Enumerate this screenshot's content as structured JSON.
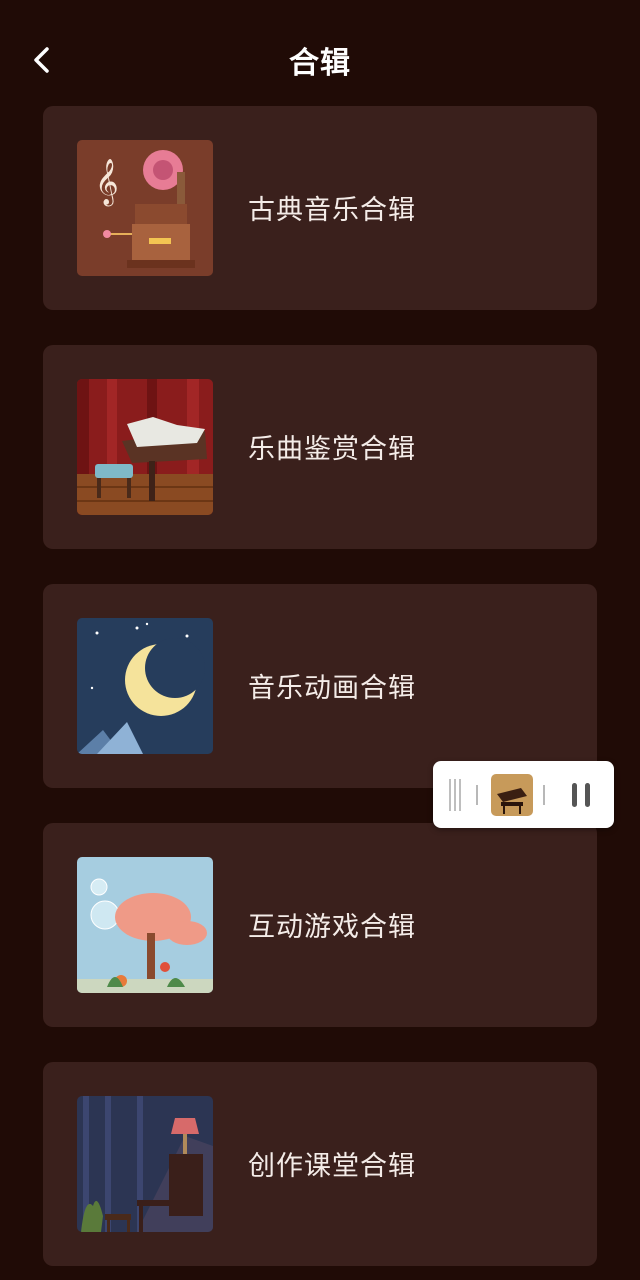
{
  "header": {
    "title": "合辑",
    "back_icon": "chevron-left-icon"
  },
  "albums": [
    {
      "label": "古典音乐合辑",
      "image": "gramophone-music-box-illustration"
    },
    {
      "label": "乐曲鉴赏合辑",
      "image": "stage-piano-illustration"
    },
    {
      "label": "音乐动画合辑",
      "image": "crescent-moon-night-illustration"
    },
    {
      "label": "互动游戏合辑",
      "image": "pink-tree-bubbles-illustration"
    },
    {
      "label": "创作课堂合辑",
      "image": "lamp-piano-room-illustration"
    }
  ],
  "mini_player": {
    "icons": [
      "drag-handle-icon",
      "piano-cover-thumbnail",
      "pause-icon"
    ]
  },
  "colors": {
    "background": "#200b06",
    "card": "#3a201c",
    "text": "#ffffff"
  }
}
